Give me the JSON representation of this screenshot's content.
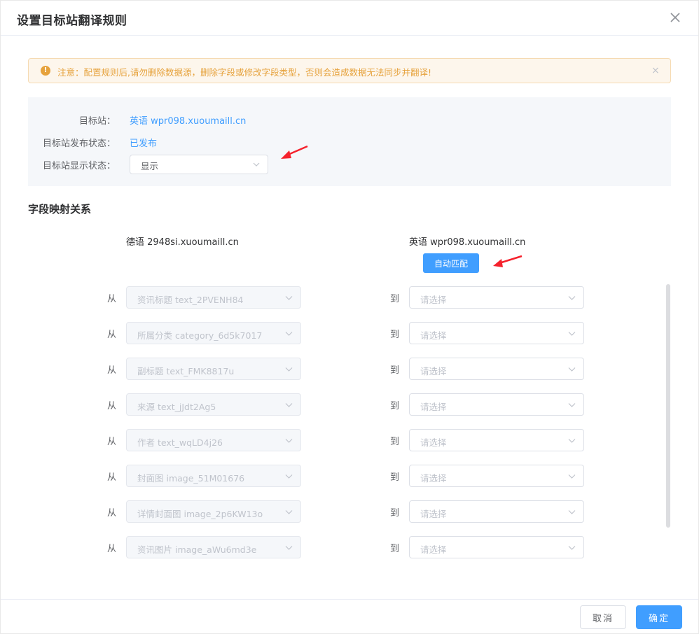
{
  "dialog": {
    "title": "设置目标站翻译规则",
    "close_icon": "close-icon"
  },
  "alert": {
    "icon": "warning-icon",
    "icon_glyph": "!",
    "text": "注意：配置规则后,请勿删除数据源，删除字段或修改字段类型，否则会造成数据无法同步并翻译!",
    "close_glyph": "×"
  },
  "target_info": {
    "site_label": "目标站：",
    "site_value": "英语 wpr098.xuoumaill.cn",
    "publish_label": "目标站发布状态：",
    "publish_value": "已发布",
    "display_label": "目标站显示状态：",
    "display_value": "显示"
  },
  "mapping": {
    "section_title": "字段映射关系",
    "source_site": "德语 2948si.xuoumaill.cn",
    "target_site": "英语 wpr098.xuoumaill.cn",
    "auto_match_label": "自动匹配",
    "from_label": "从",
    "to_label": "到",
    "rows": [
      {
        "source": "资讯标题 text_2PVENH84",
        "target_placeholder": "请选择"
      },
      {
        "source": "所属分类 category_6d5k7017",
        "target_placeholder": "请选择"
      },
      {
        "source": "副标题 text_FMK8817u",
        "target_placeholder": "请选择"
      },
      {
        "source": "来源 text_jJdt2Ag5",
        "target_placeholder": "请选择"
      },
      {
        "source": "作者 text_wqLD4j26",
        "target_placeholder": "请选择"
      },
      {
        "source": "封面图 image_51M01676",
        "target_placeholder": "请选择"
      },
      {
        "source": "详情封面图 image_2p6KW13o",
        "target_placeholder": "请选择"
      },
      {
        "source": "资讯图片 image_aWu6md3e",
        "target_placeholder": "请选择"
      }
    ]
  },
  "footer": {
    "cancel_label": "取消",
    "confirm_label": "确定"
  },
  "colors": {
    "primary": "#409eff",
    "warning": "#e6a23c",
    "warning_bg": "#fdf6ec",
    "annotation_arrow": "#f5222d"
  }
}
